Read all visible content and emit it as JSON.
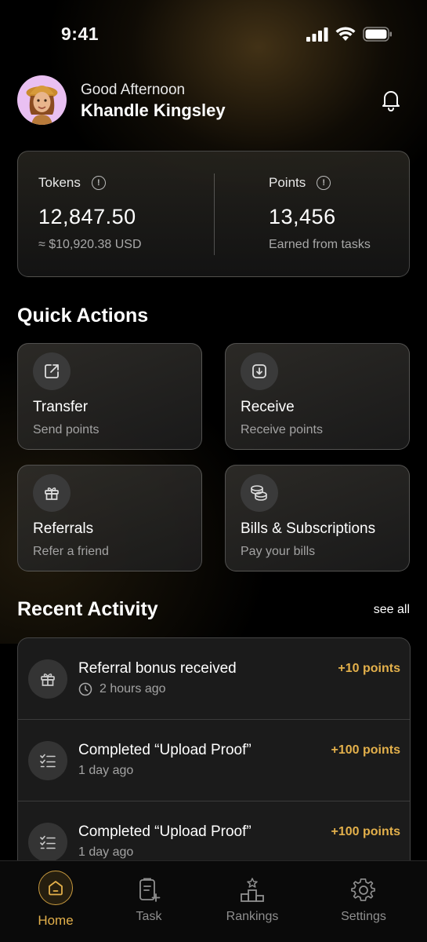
{
  "status_bar": {
    "time": "9:41"
  },
  "header": {
    "greeting": "Good Afternoon",
    "username": "Khandle Kingsley",
    "avatar_icon": "memoji-avatar",
    "notification_icon": "bell-icon"
  },
  "balance": {
    "tokens_label": "Tokens",
    "tokens_value": "12,847.50",
    "tokens_usd": "≈ $10,920.38 USD",
    "points_label": "Points",
    "points_value": "13,456",
    "points_sub": "Earned from tasks"
  },
  "quick_actions": {
    "title": "Quick Actions",
    "items": [
      {
        "label": "Transfer",
        "sub": "Send points",
        "icon": "external-link-icon"
      },
      {
        "label": "Receive",
        "sub": "Receive points",
        "icon": "download-icon"
      },
      {
        "label": "Referrals",
        "sub": "Refer a friend",
        "icon": "gift-icon"
      },
      {
        "label": "Bills & Subscriptions",
        "sub": "Pay your bills",
        "icon": "coins-icon"
      }
    ]
  },
  "recent_activity": {
    "title": "Recent Activity",
    "see_all": "see all",
    "items": [
      {
        "title": "Referral bonus received",
        "time": "2 hours ago",
        "points": "+10 points",
        "icon": "gift-icon"
      },
      {
        "title": "Completed “Upload Proof”",
        "time": "1 day ago",
        "points": "+100 points",
        "icon": "checklist-icon"
      },
      {
        "title": "Completed “Upload Proof”",
        "time": "1 day ago",
        "points": "+100 points",
        "icon": "checklist-icon"
      }
    ]
  },
  "tab_bar": {
    "tabs": [
      {
        "label": "Home",
        "icon": "home-icon",
        "active": true
      },
      {
        "label": "Task",
        "icon": "clipboard-add-icon",
        "active": false
      },
      {
        "label": "Rankings",
        "icon": "podium-icon",
        "active": false
      },
      {
        "label": "Settings",
        "icon": "gear-icon",
        "active": false
      }
    ]
  },
  "colors": {
    "accent": "#e3b04b",
    "background": "#000000",
    "card": "#1b1b1b"
  }
}
